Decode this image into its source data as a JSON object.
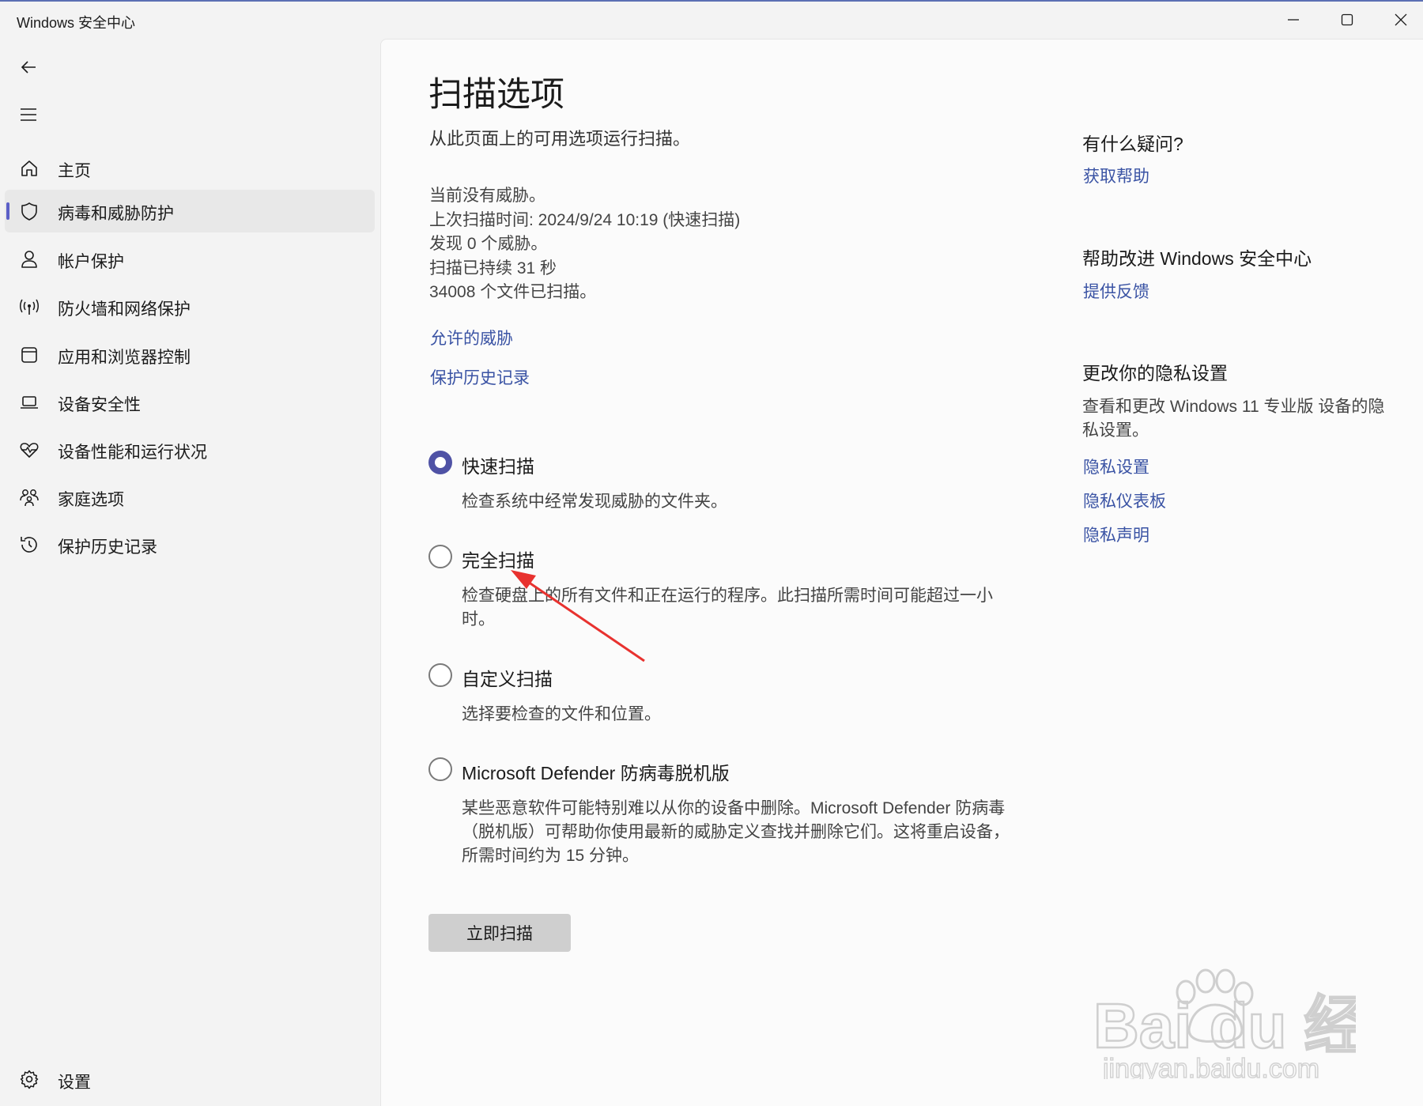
{
  "window": {
    "title": "Windows 安全中心",
    "accent_color": "#5b5fc7",
    "link_color": "#3a53a4"
  },
  "nav": {
    "back_icon": "back-arrow-icon",
    "menu_icon": "hamburger-menu-icon"
  },
  "sidebar": {
    "items": [
      {
        "label": "主页",
        "icon": "home-icon"
      },
      {
        "label": "病毒和威胁防护",
        "icon": "shield-icon",
        "active": true
      },
      {
        "label": "帐户保护",
        "icon": "person-icon"
      },
      {
        "label": "防火墙和网络保护",
        "icon": "wireless-icon"
      },
      {
        "label": "应用和浏览器控制",
        "icon": "browser-window-icon"
      },
      {
        "label": "设备安全性",
        "icon": "laptop-icon"
      },
      {
        "label": "设备性能和运行状况",
        "icon": "heart-pulse-icon"
      },
      {
        "label": "家庭选项",
        "icon": "family-icon"
      },
      {
        "label": "保护历史记录",
        "icon": "history-icon"
      }
    ],
    "settings_label": "设置"
  },
  "main": {
    "title": "扫描选项",
    "subtitle": "从此页面上的可用选项运行扫描。",
    "status": {
      "no_threats": "当前没有威胁。",
      "last_scan": "上次扫描时间: 2024/9/24 10:19 (快速扫描)",
      "threats_found": "发现 0 个威胁。",
      "duration": "扫描已持续 31 秒",
      "files_scanned": "34008 个文件已扫描。"
    },
    "links": {
      "allowed_threats": "允许的威胁",
      "protection_history": "保护历史记录"
    },
    "options": [
      {
        "label": "快速扫描",
        "desc": "检查系统中经常发现威胁的文件夹。",
        "selected": true
      },
      {
        "label": "完全扫描",
        "desc": "检查硬盘上的所有文件和正在运行的程序。此扫描所需时间可能超过一小时。",
        "selected": false
      },
      {
        "label": "自定义扫描",
        "desc": "选择要检查的文件和位置。",
        "selected": false
      },
      {
        "label": "Microsoft Defender 防病毒脱机版",
        "desc": "某些恶意软件可能特别难以从你的设备中删除。Microsoft Defender 防病毒（脱机版）可帮助你使用最新的威胁定义查找并删除它们。这将重启设备，所需时间约为 15 分钟。",
        "selected": false
      }
    ],
    "scan_now_label": "立即扫描"
  },
  "right": {
    "questions_heading": "有什么疑问?",
    "get_help": "获取帮助",
    "improve_heading": "帮助改进 Windows 安全中心",
    "feedback": "提供反馈",
    "privacy_heading": "更改你的隐私设置",
    "privacy_text": "查看和更改 Windows 11 专业版 设备的隐私设置。",
    "privacy_settings": "隐私设置",
    "privacy_dashboard": "隐私仪表板",
    "privacy_statement": "隐私声明"
  },
  "overlay": {
    "arrow_color": "#e8322f",
    "watermark_brand": "Bai du 经验",
    "watermark_url": "jingyan.baidu.com"
  }
}
